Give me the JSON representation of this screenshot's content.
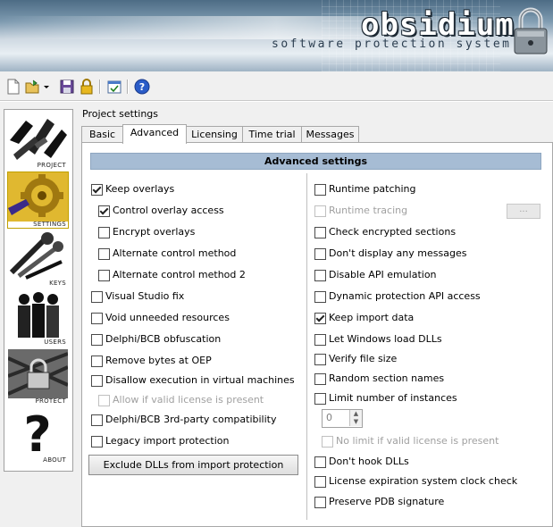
{
  "banner": {
    "logo": "obsidium",
    "tagline": "software protection system"
  },
  "toolbar": {
    "icons": [
      "new-file-icon",
      "open-folder-icon",
      "dropdown-arrow-icon",
      "save-icon",
      "lock-icon",
      "check-icon",
      "help-icon"
    ]
  },
  "sidebar": {
    "items": [
      {
        "label": "PROJECT"
      },
      {
        "label": "SETTINGS"
      },
      {
        "label": "KEYS"
      },
      {
        "label": "USERS"
      },
      {
        "label": "PROTECT"
      },
      {
        "label": "ABOUT"
      }
    ]
  },
  "main": {
    "section_label": "Project settings",
    "tabs": [
      {
        "label": "Basic"
      },
      {
        "label": "Advanced"
      },
      {
        "label": "Licensing"
      },
      {
        "label": "Time trial"
      },
      {
        "label": "Messages"
      }
    ],
    "active_tab": "Advanced",
    "header": "Advanced settings",
    "left_options": [
      {
        "label": "Keep overlays",
        "checked": true,
        "disabled": false
      },
      {
        "label": "Control overlay access",
        "checked": true,
        "disabled": false
      },
      {
        "label": "Encrypt overlays",
        "checked": false,
        "disabled": false
      },
      {
        "label": "Alternate control method",
        "checked": false,
        "disabled": false
      },
      {
        "label": "Alternate control method 2",
        "checked": false,
        "disabled": false
      },
      {
        "label": "Visual Studio fix",
        "checked": false,
        "disabled": false
      },
      {
        "label": "Void unneeded resources",
        "checked": false,
        "disabled": false
      },
      {
        "label": "Delphi/BCB obfuscation",
        "checked": false,
        "disabled": false
      },
      {
        "label": "Remove bytes at OEP",
        "checked": false,
        "disabled": false
      },
      {
        "label": "Disallow execution in virtual machines",
        "checked": false,
        "disabled": false
      },
      {
        "label": "Allow if valid license is present",
        "checked": false,
        "disabled": true
      },
      {
        "label": "Delphi/BCB 3rd-party compatibility",
        "checked": false,
        "disabled": false
      },
      {
        "label": "Legacy import protection",
        "checked": false,
        "disabled": false
      }
    ],
    "exclude_button": "Exclude DLLs from import protection",
    "right_options": [
      {
        "label": "Runtime patching",
        "checked": false,
        "disabled": false
      },
      {
        "label": "Runtime tracing",
        "checked": false,
        "disabled": true
      },
      {
        "label": "Check encrypted sections",
        "checked": false,
        "disabled": false
      },
      {
        "label": "Don't display any messages",
        "checked": false,
        "disabled": false
      },
      {
        "label": "Disable API emulation",
        "checked": false,
        "disabled": false
      },
      {
        "label": "Dynamic protection API access",
        "checked": false,
        "disabled": false
      },
      {
        "label": "Keep import data",
        "checked": true,
        "disabled": false
      },
      {
        "label": "Let Windows load DLLs",
        "checked": false,
        "disabled": false
      },
      {
        "label": "Verify file size",
        "checked": false,
        "disabled": false
      },
      {
        "label": "Random section names",
        "checked": false,
        "disabled": false
      },
      {
        "label": "Limit number of instances",
        "checked": false,
        "disabled": false
      },
      {
        "label": "No limit if valid license is present",
        "checked": false,
        "disabled": true
      },
      {
        "label": "Don't hook DLLs",
        "checked": false,
        "disabled": false
      },
      {
        "label": "License expiration system clock check",
        "checked": false,
        "disabled": false
      },
      {
        "label": "Preserve PDB signature",
        "checked": false,
        "disabled": false
      }
    ],
    "tracing_button": "...",
    "instances_value": "0"
  },
  "colors": {
    "header_bg": "#a6bcd4",
    "banner_dark": "#4d6c85"
  }
}
